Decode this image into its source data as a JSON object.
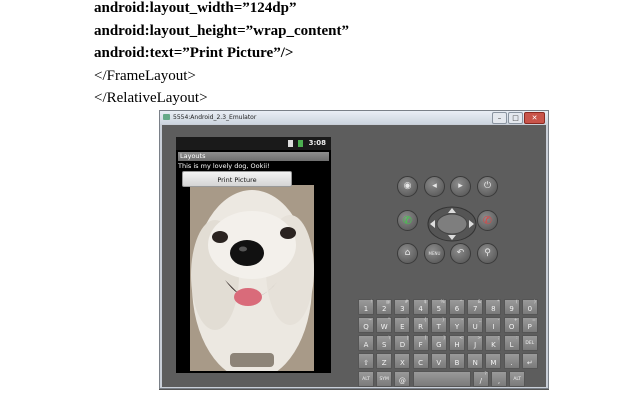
{
  "code": {
    "lines": [
      "android:layout_width=”124dp”",
      "android:layout_height=”wrap_content”",
      "android:text=”Print Picture”/>",
      "</FrameLayout>",
      "</RelativeLayout>"
    ]
  },
  "emulator": {
    "window_title": "5554:Android_2.3_Emulator",
    "window_buttons": {
      "minimize": "–",
      "maximize": "□",
      "close": "✕"
    },
    "status_clock": "3:08",
    "app_title": "Layouts",
    "app_text": "This is my lovely dog, Ookii!",
    "button_label": "Print Picture",
    "photo_icon": "white-dog-photo",
    "hardware_buttons": [
      {
        "name": "camera",
        "glyph": "◉"
      },
      {
        "name": "volume-down",
        "glyph": "◂"
      },
      {
        "name": "volume-up",
        "glyph": "▸"
      },
      {
        "name": "power",
        "glyph": "⏻"
      },
      {
        "name": "call",
        "glyph": "✆"
      },
      {
        "name": "end-call",
        "glyph": "✆"
      },
      {
        "name": "home",
        "glyph": "⌂"
      },
      {
        "name": "menu",
        "glyph": "MENU"
      },
      {
        "name": "back",
        "glyph": "↶"
      },
      {
        "name": "search",
        "glyph": "⚲"
      }
    ],
    "keyboard": {
      "rows": [
        [
          [
            "1",
            "!"
          ],
          [
            "2",
            "@"
          ],
          [
            "3",
            "#"
          ],
          [
            "4",
            "$"
          ],
          [
            "5",
            "%"
          ],
          [
            "6",
            "^"
          ],
          [
            "7",
            "&"
          ],
          [
            "8",
            "*"
          ],
          [
            "9",
            "("
          ],
          [
            "0",
            ")"
          ]
        ],
        [
          [
            "Q",
            "~"
          ],
          [
            "W",
            "\""
          ],
          [
            "E",
            "`"
          ],
          [
            "R",
            "{"
          ],
          [
            "T",
            "}"
          ],
          [
            "Y",
            "-"
          ],
          [
            "U",
            "_"
          ],
          [
            "I",
            "-"
          ],
          [
            "O",
            "+"
          ],
          [
            "P",
            "="
          ]
        ],
        [
          [
            "A",
            ""
          ],
          [
            "S",
            "\\"
          ],
          [
            "D",
            "|"
          ],
          [
            "F",
            "["
          ],
          [
            "G",
            "]"
          ],
          [
            "H",
            "<"
          ],
          [
            "J",
            ">"
          ],
          [
            "K",
            ";"
          ],
          [
            "L",
            ":"
          ],
          [
            "DEL",
            ""
          ]
        ],
        [
          [
            "⇧",
            ""
          ],
          [
            "Z",
            ""
          ],
          [
            "X",
            ""
          ],
          [
            "C",
            ""
          ],
          [
            "V",
            ""
          ],
          [
            "B",
            ""
          ],
          [
            "N",
            ""
          ],
          [
            "M",
            ""
          ],
          [
            ".",
            ""
          ],
          [
            "↵",
            ""
          ]
        ],
        [
          [
            "ALT",
            ""
          ],
          [
            "SYM",
            ""
          ],
          [
            "@",
            ""
          ],
          [
            "",
            ""
          ],
          [
            "/",
            "?"
          ],
          [
            ",",
            ""
          ],
          [
            "ALT",
            ""
          ]
        ]
      ]
    },
    "colors": {
      "body": "#5d5d5d",
      "call": "#3fcf48",
      "end_call": "#e04444"
    }
  }
}
